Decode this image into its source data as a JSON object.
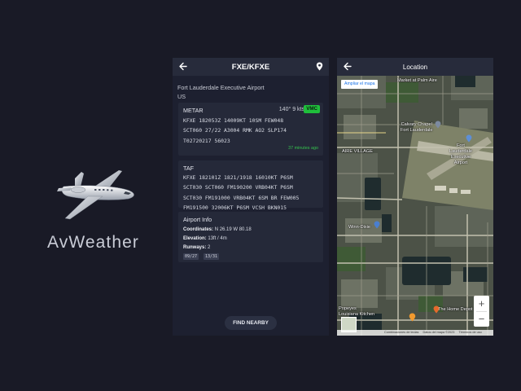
{
  "brand": {
    "name": "AvWeather"
  },
  "detail": {
    "title": "FXE/KFXE",
    "airport_name": "Fort Lauderdale Executive Airport",
    "country": "US",
    "metar": {
      "heading": "METAR",
      "wind": "140° 9 kts",
      "category": "VMC",
      "category_color": "#1fbf3b",
      "raw": "KFXE 182053Z 14009KT 10SM FEW048\nSCT060 27/22 A3004 RMK AO2 SLP174\nT02720217 56023",
      "age": "37 minutes ago"
    },
    "taf": {
      "heading": "TAF",
      "raw": "KFXE 182101Z 1821/1918 16010KT P6SM\nSCT030 SCT060 FM190200 VRB04KT P6SM\nSCT030 FM191000 VRB04KT 6SM BR FEW005\nFM191500 32006KT P6SM VCSH BKN015"
    },
    "info": {
      "heading": "Airport Info",
      "coordinates_label": "Coordinates:",
      "coordinates_value": "N 26.19 W 80.18",
      "elevation_label": "Elevation:",
      "elevation_value": "13ft / 4m",
      "runways_label": "Runways:",
      "runways_value": "2",
      "runways": [
        "09/27",
        "13/31"
      ]
    },
    "find_nearby": "FIND NEARBY"
  },
  "map": {
    "title": "Location",
    "expand_label": "Ampliar el mapa",
    "labels": {
      "market": "Market at Palm Aire",
      "calvary": "Calvary Chapel\nFort Lauderdale",
      "airport": "Fort\nLauderdale\nExecutive\nAirport",
      "village": "AIRE VILLAGE",
      "winndixie": "Winn-Dixie",
      "popeyes": "Popeyes\nLouisiana Kitchen",
      "homedepot": "The Home Depot",
      "depot_svc": "La Ra..."
    },
    "footer": [
      "Combinaciones de teclas",
      "Datos del mapa ©2023",
      "Términos de uso"
    ],
    "zoom_in": "+",
    "zoom_out": "−"
  }
}
